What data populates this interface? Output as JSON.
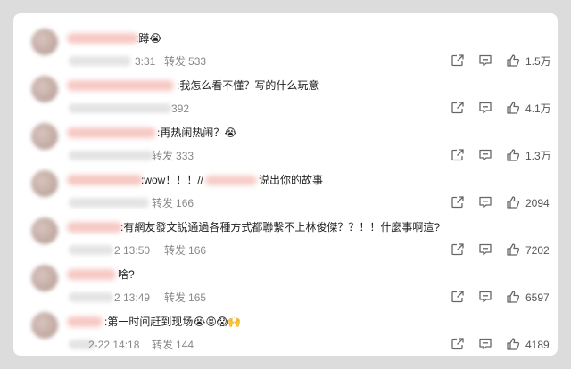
{
  "comments": [
    {
      "text_before": ":蹲",
      "emoji": "😭",
      "time": "3:31",
      "repost_label": "转发",
      "repost": "533",
      "likes": "1.5万"
    },
    {
      "text_before": ":我怎么看不懂？写的什么玩意",
      "emoji": "",
      "time": "",
      "repost_label": "转发",
      "repost": "392",
      "likes": "4.1万"
    },
    {
      "text_before": ":再热闹热闹？",
      "emoji": "😭",
      "time": "",
      "repost_label": "转发",
      "repost": "333",
      "likes": "1.3万"
    },
    {
      "text_before": ":wow！！！//",
      "text_after": "说出你的故事",
      "emoji": "",
      "time": "",
      "repost_label": "转发",
      "repost": "166",
      "likes": "2094"
    },
    {
      "text_before": ":有網友發文說通過各種方式都聯繫不上林俊傑？？！！什麼事啊這?",
      "emoji": "",
      "time": "2 13:50",
      "repost_label": "转发",
      "repost": "166",
      "likes": "7202"
    },
    {
      "text_before": "啥?",
      "emoji": "",
      "time": "2 13:49",
      "repost_label": "转发",
      "repost": "165",
      "likes": "6597"
    },
    {
      "text_before": ":第一时间赶到现场",
      "emoji": "😭😝😱🙌",
      "time": "2-22 14:18",
      "repost_label": "转发",
      "repost": "144",
      "likes": "4189"
    }
  ],
  "icons": {
    "share": "share-icon",
    "comment": "comment-icon",
    "like": "thumbs-up-icon"
  },
  "colors": {
    "card_bg": "#ffffff",
    "page_bg": "#dcdcdc",
    "muted": "#888888",
    "blur_pink": "#f3b6b0"
  }
}
